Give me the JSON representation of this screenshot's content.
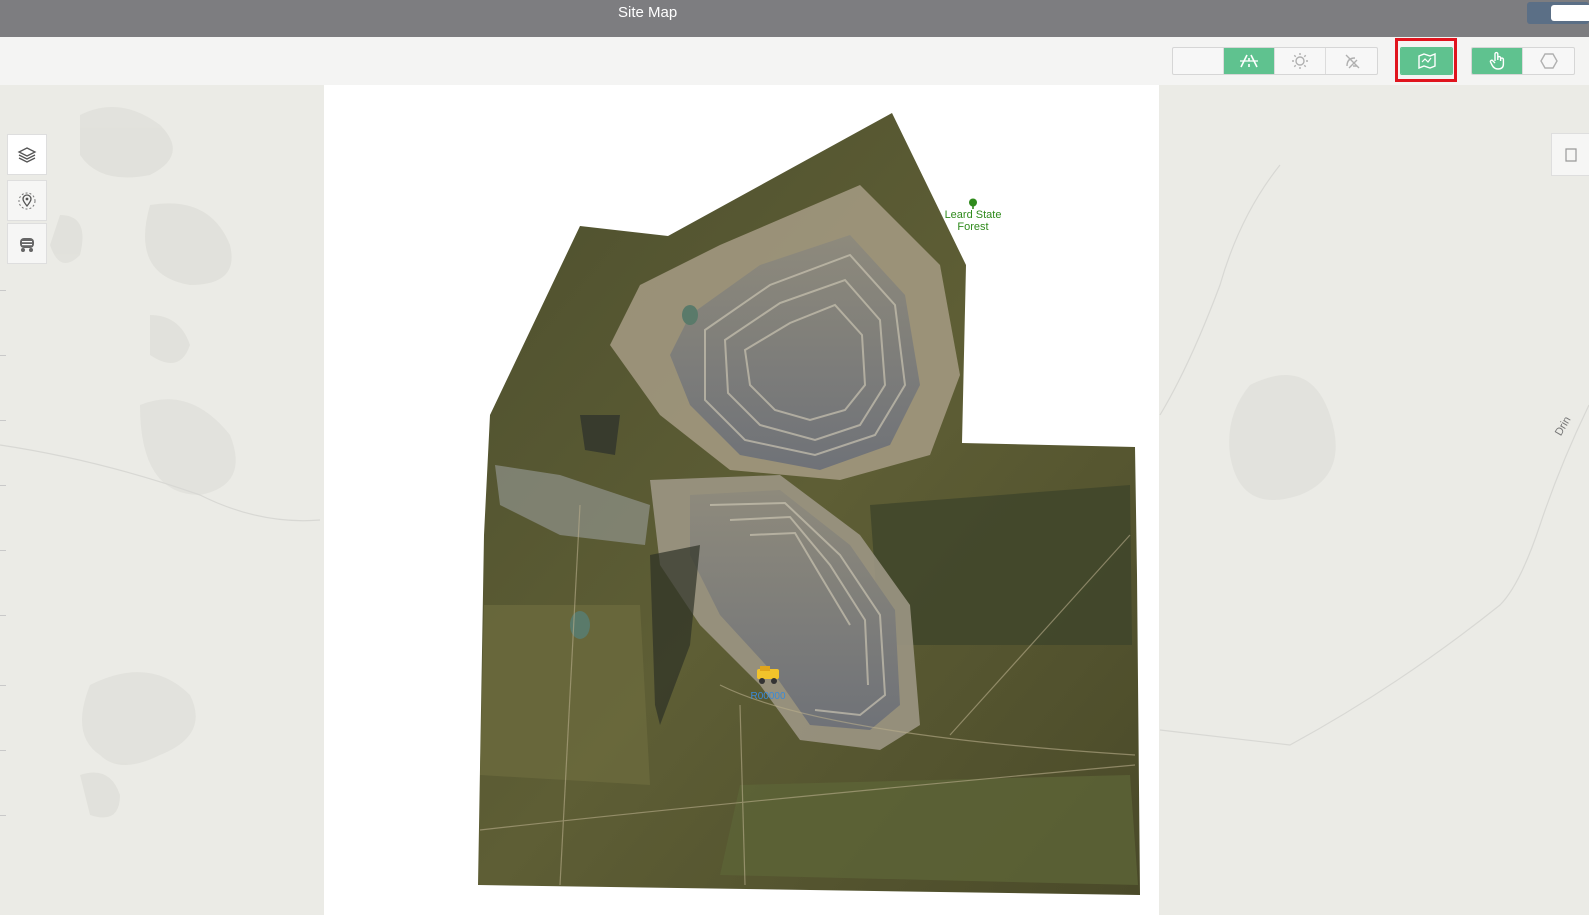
{
  "window": {
    "title": "Site Map"
  },
  "toolbar": {
    "group1": [
      {
        "icon": "blank",
        "active": false
      },
      {
        "icon": "road-icon",
        "active": true
      },
      {
        "icon": "sun-icon",
        "active": false
      },
      {
        "icon": "satellite-off-icon",
        "active": false
      }
    ],
    "group2": [
      {
        "icon": "map-icon",
        "active": true
      }
    ],
    "group3": [
      {
        "icon": "hand-pointer-icon",
        "active": true
      },
      {
        "icon": "hexagon-icon",
        "active": false
      }
    ]
  },
  "sidebar": {
    "items": [
      "layers-icon",
      "location-pin-icon",
      "truck-icon"
    ]
  },
  "map": {
    "labels": {
      "forest": "Leard State\nForest",
      "truck": "R00000",
      "road_partial": "Drin"
    }
  },
  "colors": {
    "accent": "#5fc28f",
    "highlight": "#e0141e",
    "titlebar": "#7d7d80"
  }
}
